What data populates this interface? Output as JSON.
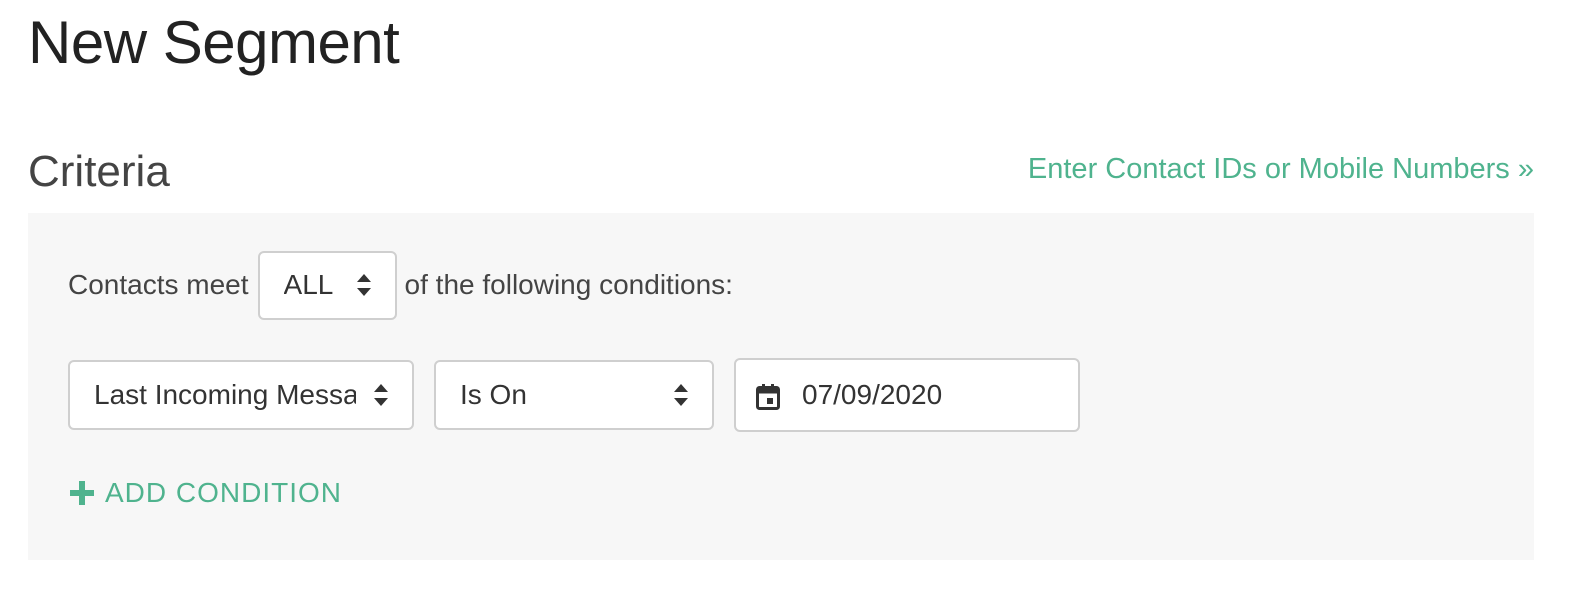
{
  "page": {
    "title": "New Segment"
  },
  "criteria": {
    "section_title": "Criteria",
    "contact_ids_link": "Enter Contact IDs or Mobile Numbers »",
    "match": {
      "prefix": "Contacts meet",
      "selected": "ALL",
      "suffix": "of the following conditions:"
    },
    "conditions": [
      {
        "attribute": "Last Incoming Message",
        "operator": "Is On",
        "value": "07/09/2020",
        "value_icon": "calendar-icon"
      }
    ],
    "add_condition_label": "ADD CONDITION",
    "add_condition_icon": "plus-icon"
  },
  "colors": {
    "accent": "#4fb38e",
    "panel_background": "#f7f7f7",
    "border": "#cfcfcf"
  }
}
